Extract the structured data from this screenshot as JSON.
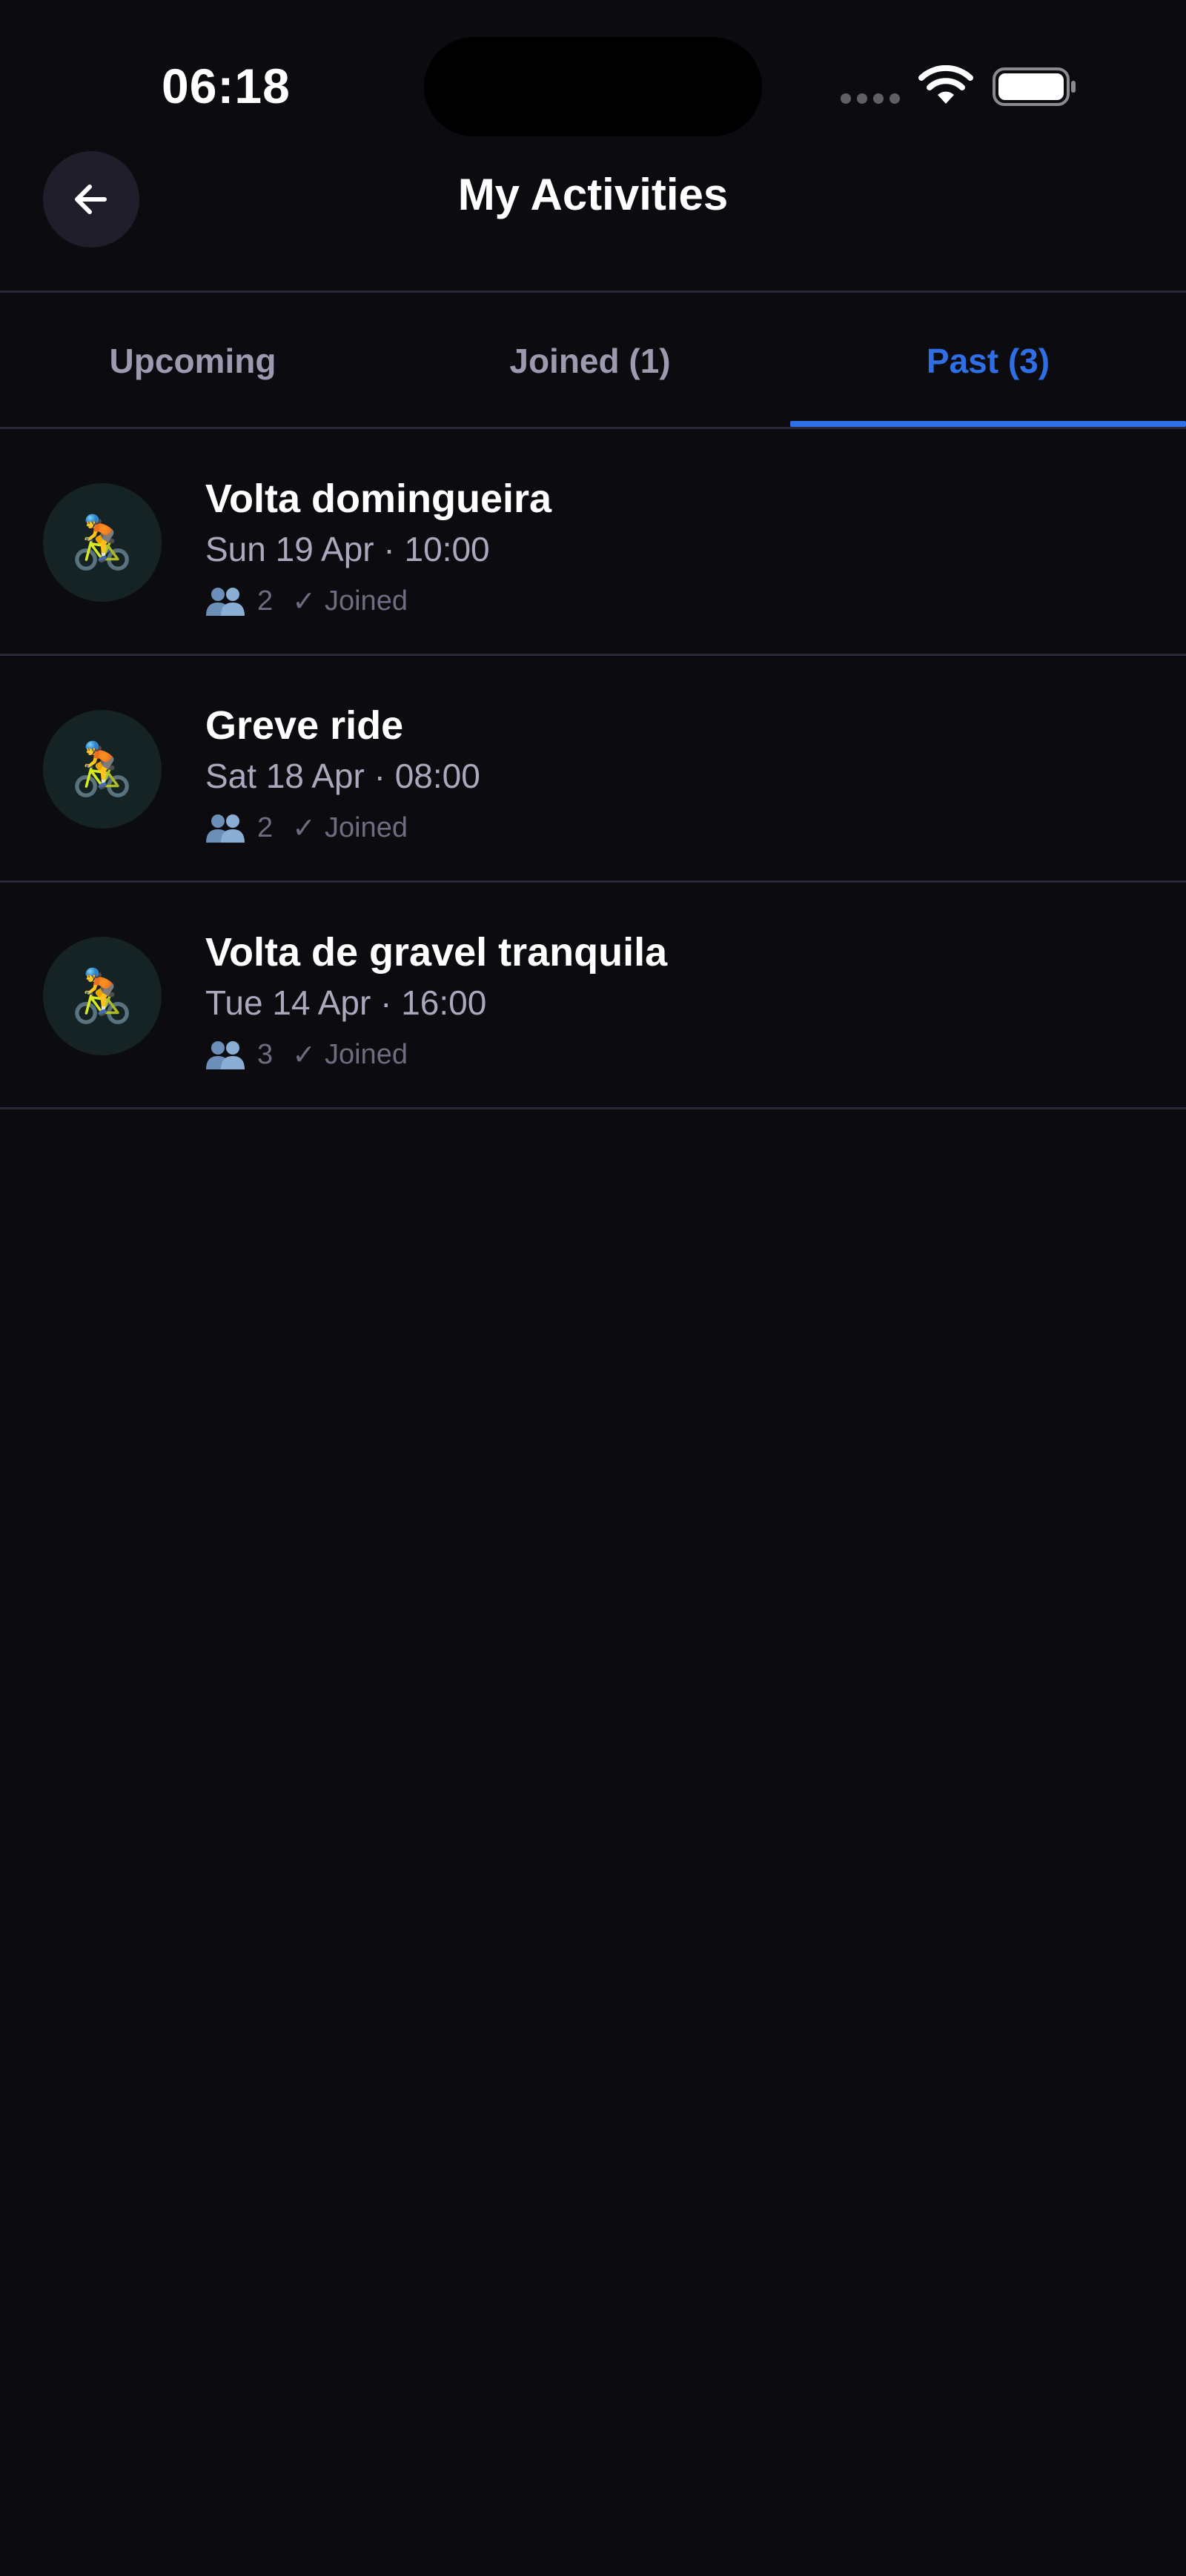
{
  "status_bar": {
    "time": "06:18",
    "wifi_icon": "wifi-icon",
    "battery_icon": "battery-icon"
  },
  "header": {
    "title": "My Activities",
    "back_icon": "arrow-left-icon"
  },
  "tabs": [
    {
      "label": "Upcoming",
      "active": false
    },
    {
      "label": "Joined (1)",
      "active": false
    },
    {
      "label": "Past (3)",
      "active": true
    }
  ],
  "activities": [
    {
      "title": "Volta domingueira",
      "date": "Sun 19 Apr · 10:00",
      "participants": "2",
      "status": "Joined",
      "status_icon": "✓",
      "icon": "cyclist-icon",
      "emoji": "🚴"
    },
    {
      "title": "Greve ride",
      "date": "Sat 18 Apr · 08:00",
      "participants": "2",
      "status": "Joined",
      "status_icon": "✓",
      "icon": "cyclist-icon",
      "emoji": "🚴"
    },
    {
      "title": "Volta de gravel tranquila",
      "date": "Tue 14 Apr · 16:00",
      "participants": "3",
      "status": "Joined",
      "status_icon": "✓",
      "icon": "cyclist-icon",
      "emoji": "🚴"
    }
  ],
  "colors": {
    "background": "#0c0c10",
    "accent": "#2f6fe6",
    "tab_inactive": "#9b9aae",
    "secondary_text": "#a9a8bc",
    "muted_text": "#6d6c80",
    "divider": "#2a2a36"
  }
}
